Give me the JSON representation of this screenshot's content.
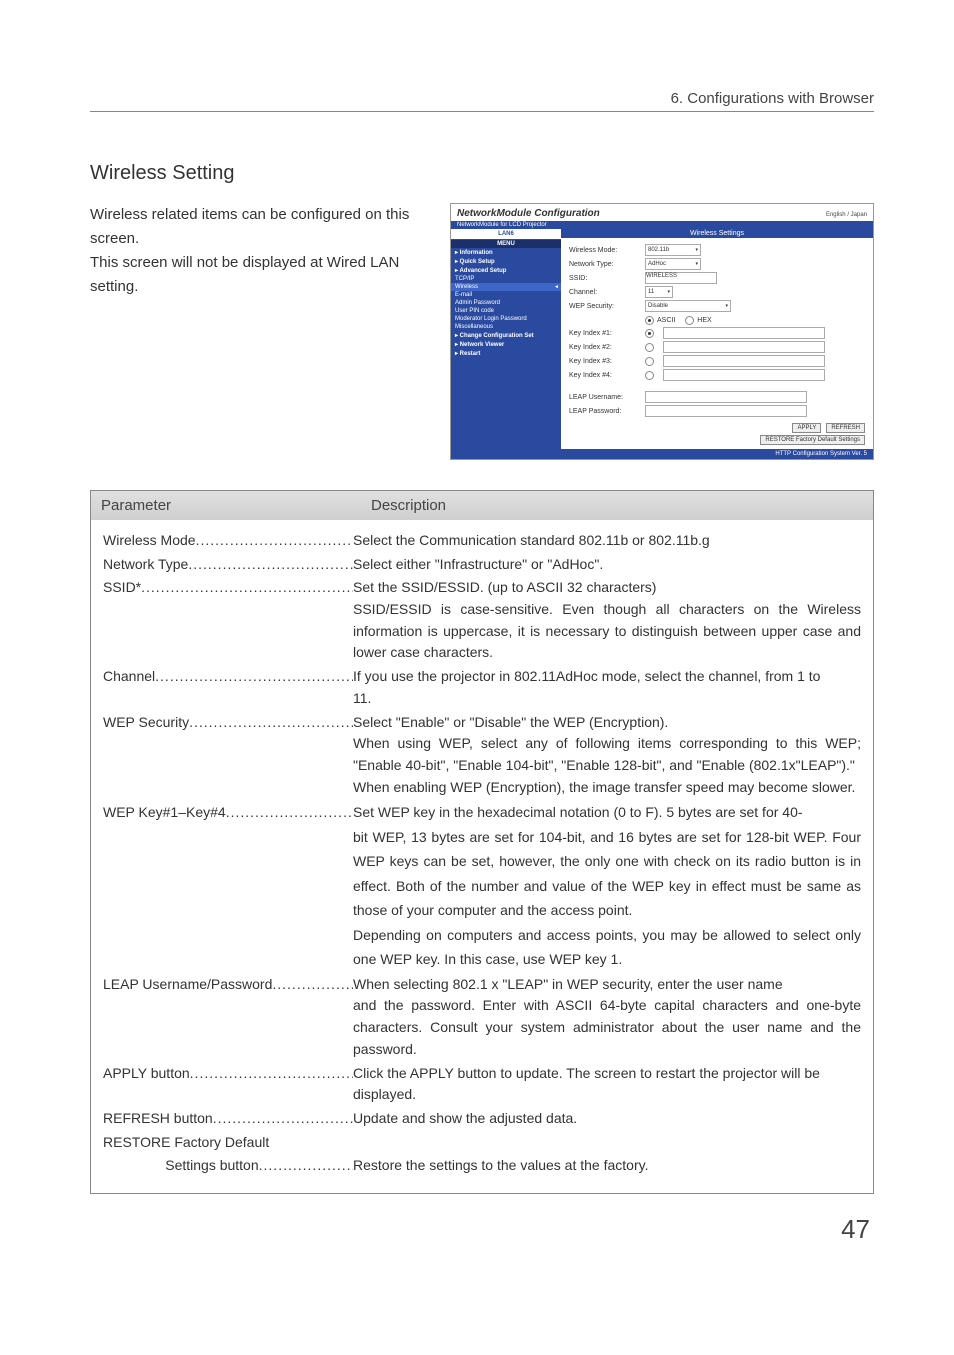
{
  "header": {
    "title": "6. Configurations with Browser"
  },
  "section_title": "Wireless Setting",
  "intro": [
    "Wireless related items can be configured on this screen.",
    "This screen will not be displayed at Wired LAN setting."
  ],
  "screenshot": {
    "title": "NetworkModule Configuration",
    "lang": "English / Japan",
    "subtitle": "NetworkModule for LCD Projector",
    "side_header": "LAN6",
    "side_menu_label": "MENU",
    "side_items": [
      {
        "label": "Information",
        "bold": true
      },
      {
        "label": "Quick Setup",
        "bold": true
      },
      {
        "label": "Advanced Setup",
        "bold": true
      },
      {
        "label": "TCP/IP",
        "bold": false
      },
      {
        "label": "Wireless",
        "bold": false,
        "selected": true
      },
      {
        "label": "E-mail",
        "bold": false
      },
      {
        "label": "Admin Password",
        "bold": false
      },
      {
        "label": "User PIN code",
        "bold": false
      },
      {
        "label": "Moderator Login Password",
        "bold": false
      },
      {
        "label": "Miscellaneous",
        "bold": false
      },
      {
        "label": "Change Configuration Set",
        "bold": true
      },
      {
        "label": "Network Viewer",
        "bold": true
      },
      {
        "label": "Restart",
        "bold": true
      }
    ],
    "main_header": "Wireless Settings",
    "fields": {
      "wireless_mode": {
        "label": "Wireless Mode:",
        "value": "802.11b"
      },
      "network_type": {
        "label": "Network Type:",
        "value": "AdHoc"
      },
      "ssid": {
        "label": "SSID:",
        "value": "WIRELESS"
      },
      "channel": {
        "label": "Channel:",
        "value": "11"
      },
      "wep_security": {
        "label": "WEP Security:",
        "value": "Disable"
      },
      "ascii": "ASCII",
      "hex": "HEX",
      "key1": "Key Index #1:",
      "key2": "Key Index #2:",
      "key3": "Key Index #3:",
      "key4": "Key Index #4:",
      "leap_user": "LEAP Username:",
      "leap_pass": "LEAP Password:"
    },
    "buttons": {
      "apply": "APPLY",
      "refresh": "REFRESH",
      "restore": "RESTORE Factory Default Settings"
    },
    "footer": "HTTP Configuration System Ver. 5"
  },
  "param_header": {
    "c1": "Parameter",
    "c2": "Description"
  },
  "params": [
    {
      "name": "Wireless Mode",
      "first": "Select the Communication standard 802.11b or 802.11b.g",
      "cont": []
    },
    {
      "name": "Network Type",
      "first": "Select either \"Infrastructure\" or \"AdHoc\".",
      "cont": []
    },
    {
      "name": "SSID*",
      "first": "Set the SSID/ESSID. (up to ASCII 32 characters)",
      "cont": [
        "SSID/ESSID is case-sensitive. Even though all characters on the Wireless information is uppercase, it is necessary to distinguish between upper case and lower case characters."
      ],
      "cont_align": "justify"
    },
    {
      "name": "Channel",
      "first": "If you use the projector in 802.11AdHoc mode, select the channel, from 1 to",
      "cont": [
        "11."
      ],
      "cont_align": "left"
    },
    {
      "name": "WEP Security",
      "first": "Select \"Enable\" or \"Disable\" the WEP (Encryption).",
      "cont": [
        "When using WEP, select any of following items corresponding to this WEP; \"Enable 40-bit\", \"Enable 104-bit\", \"Enable 128-bit\", and \"Enable (802.1x\"LEAP\").\"",
        "When enabling WEP (Encryption), the image transfer speed may become slower."
      ],
      "cont_align": "justify"
    },
    {
      "name": "WEP Key#1–Key#4",
      "first": "Set WEP key in the hexadecimal notation (0 to F). 5 bytes are set for 40-",
      "cont": [
        "bit WEP, 13 bytes are set for 104-bit, and 16 bytes are set for 128-bit WEP. Four WEP keys can be set, however, the only one with check on its radio button is in effect. Both of the number and value of the WEP key in effect must be same as those of your computer and the access point.",
        "Depending on computers and access points, you may be allowed to select only one WEP key. In this case, use WEP key 1."
      ],
      "cont_align": "justify",
      "line_height": "1.75"
    },
    {
      "name": "LEAP Username/Password",
      "first": "When selecting 802.1 x \"LEAP\" in WEP security, enter the user name",
      "cont": [
        "and the password. Enter with ASCII 64-byte capital characters and one-byte characters. Consult your system administrator about the user name and the password."
      ],
      "cont_align": "justify"
    },
    {
      "name": "APPLY button",
      "first": "Click the APPLY button to update. The screen to restart the projector will be",
      "cont": [
        "displayed."
      ],
      "cont_align": "left"
    },
    {
      "name": "REFRESH button",
      "first": "Update and show the adjusted data.",
      "cont": []
    },
    {
      "name": "RESTORE Factory Default",
      "plain": true
    },
    {
      "name_indent": "                Settings button",
      "first": "Restore the settings to the values at the factory.",
      "cont": [],
      "indent": true
    }
  ],
  "page_number": "47"
}
